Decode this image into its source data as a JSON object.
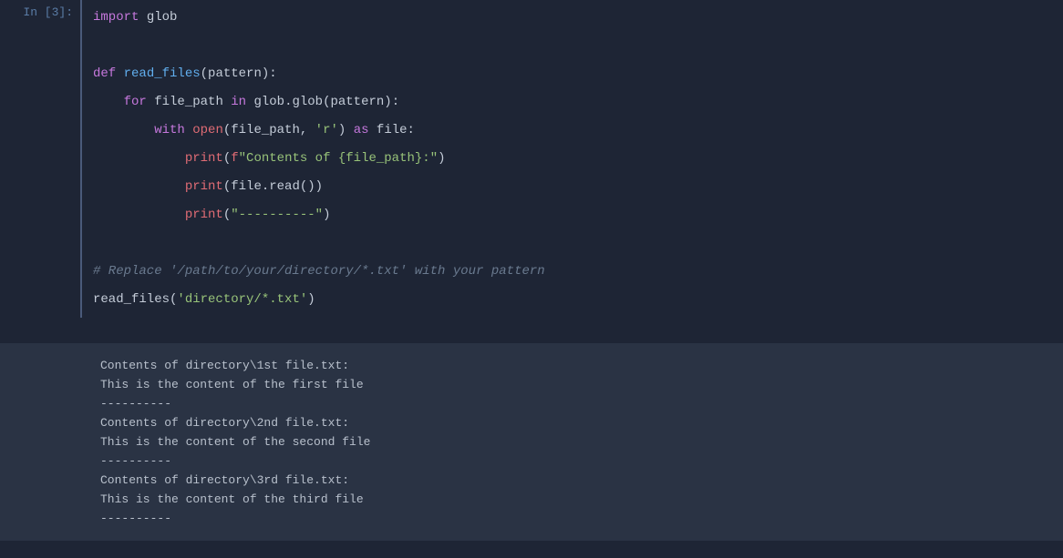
{
  "prompt": "In [3]:",
  "code": {
    "l1_kw": "import",
    "l1_mod": " glob",
    "l3_kw": "def",
    "l3_fn": " read_files",
    "l3_rest": "(pattern):",
    "l4_indent": "    ",
    "l4_kw1": "for",
    "l4_var": " file_path ",
    "l4_kw2": "in",
    "l4_call": " glob.glob(pattern):",
    "l5_indent": "        ",
    "l5_kw1": "with",
    "l5_sp1": " ",
    "l5_open": "open",
    "l5_p1": "(file_path, ",
    "l5_str": "'r'",
    "l5_p2": ") ",
    "l5_kw2": "as",
    "l5_rest": " file:",
    "l6_indent": "            ",
    "l6_print": "print",
    "l6_p1": "(",
    "l6_f": "f",
    "l6_str": "\"Contents of {file_path}:\"",
    "l6_p2": ")",
    "l7_indent": "            ",
    "l7_print": "print",
    "l7_rest": "(file.read())",
    "l8_indent": "            ",
    "l8_print": "print",
    "l8_p1": "(",
    "l8_str": "\"----------\"",
    "l8_p2": ")",
    "l10_comment": "# Replace '/path/to/your/directory/*.txt' with your pattern",
    "l11_fn": "read_files",
    "l11_p1": "(",
    "l11_str": "'directory/*.txt'",
    "l11_p2": ")"
  },
  "output": {
    "o1": "Contents of directory\\1st file.txt:",
    "o2": "This is the content of the first file",
    "o3": "----------",
    "o4": "Contents of directory\\2nd file.txt:",
    "o5": "This is the content of the second file",
    "o6": "----------",
    "o7": "Contents of directory\\3rd file.txt:",
    "o8": "This is the content of the third file",
    "o9": "----------"
  }
}
